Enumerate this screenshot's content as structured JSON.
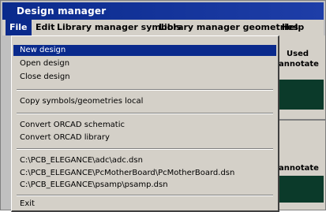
{
  "window": {
    "title": "Design manager"
  },
  "menubar": {
    "items": [
      {
        "label": "File"
      },
      {
        "label": "Edit"
      },
      {
        "label": "Library manager symbols"
      },
      {
        "label": "Library manager geometries"
      },
      {
        "label": "Help"
      }
    ]
  },
  "file_menu": {
    "items": [
      {
        "label": "New design"
      },
      {
        "label": "Open design"
      },
      {
        "label": "Close design"
      },
      {
        "label": "Copy symbols/geometries local"
      },
      {
        "label": "Convert ORCAD schematic"
      },
      {
        "label": "Convert ORCAD library"
      },
      {
        "label": "C:\\PCB_ELEGANCE\\adc\\adc.dsn"
      },
      {
        "label": "C:\\PCB_ELEGANCE\\PcMotherBoard\\PcMotherBoard.dsn"
      },
      {
        "label": "C:\\PCB_ELEGANCE\\psamp\\psamp.dsn"
      },
      {
        "label": "Exit"
      }
    ]
  },
  "background": {
    "label_top_1": "Used",
    "label_top_2": "annotate",
    "label_bottom": "annotate"
  },
  "colors": {
    "titlebar": "#0a2a8c",
    "menu_highlight": "#0a2a8c",
    "menu_bg": "#d4d0c8",
    "panel_dark": "#0b3a2a"
  }
}
